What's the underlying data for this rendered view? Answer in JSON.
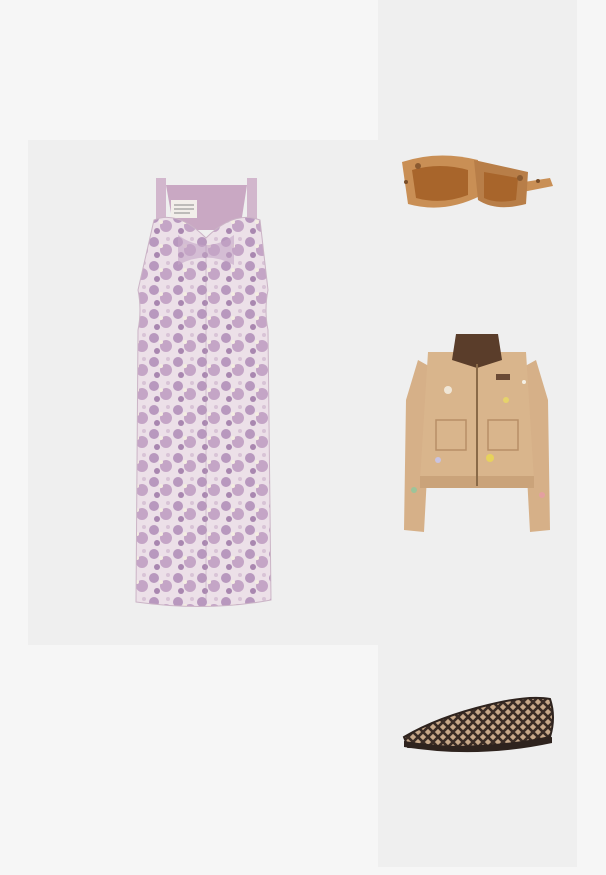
{
  "outfit": {
    "items": [
      {
        "name": "dress",
        "icon": "floral-jacquard-dress-icon",
        "colors": {
          "base": "#ebdde6",
          "print": "#b696bb",
          "lining": "#c9a8c3"
        }
      },
      {
        "name": "sunglasses",
        "icon": "tortoiseshell-sunglasses-icon",
        "colors": {
          "frame": "#c98f55",
          "lens": "#a8652b"
        }
      },
      {
        "name": "jacket",
        "icon": "canvas-work-jacket-icon",
        "colors": {
          "body": "#d9b58c",
          "collar": "#5a3d2a"
        }
      },
      {
        "name": "shoe",
        "icon": "woven-flat-shoe-icon",
        "colors": {
          "leather": "#3a2c25",
          "lining": "#c7a889"
        }
      }
    ],
    "background": "#f6f6f6",
    "tile_background": "#efefef"
  }
}
